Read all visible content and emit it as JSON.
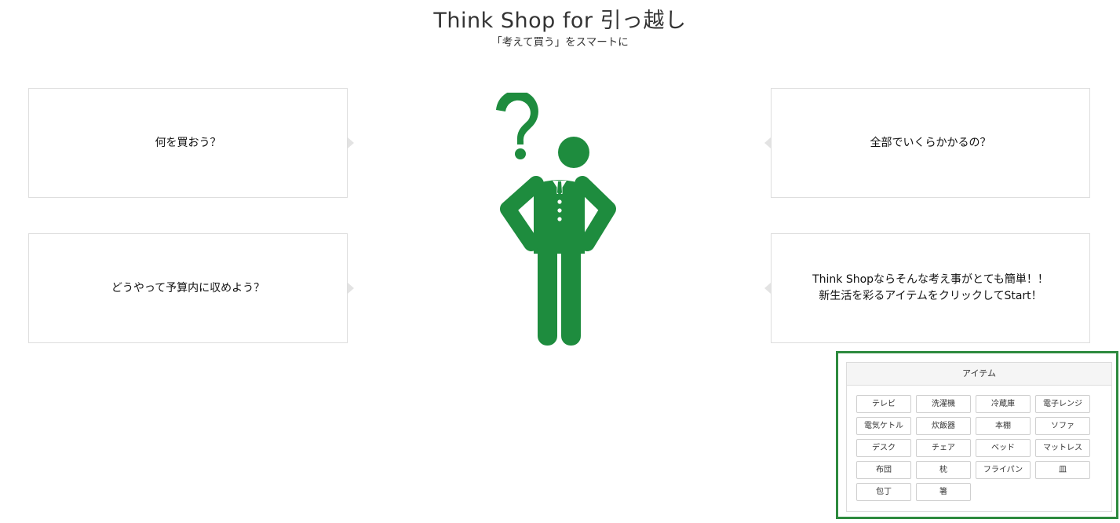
{
  "header": {
    "title": "Think Shop for 引っ越し",
    "subtitle": "「考えて買う」をスマートに"
  },
  "bubbles": {
    "top_left": "何を買おう？",
    "bottom_left": "どうやって予算内に収めよう？",
    "top_right": "全部でいくらかかるの？",
    "bottom_right_line1": "Think Shopならそんな考え事がとても簡単！！",
    "bottom_right_line2": "新生活を彩るアイテムをクリックしてStart！"
  },
  "illustration": {
    "icon": "thinking-businessman-icon",
    "color": "#1e8c3e"
  },
  "items_panel": {
    "header": "アイテム",
    "highlight_color": "#2d8a3e",
    "items": [
      "テレビ",
      "洗濯機",
      "冷蔵庫",
      "電子レンジ",
      "電気ケトル",
      "炊飯器",
      "本棚",
      "ソファ",
      "デスク",
      "チェア",
      "ベッド",
      "マットレス",
      "布団",
      "枕",
      "フライパン",
      "皿",
      "包丁",
      "箸"
    ]
  }
}
